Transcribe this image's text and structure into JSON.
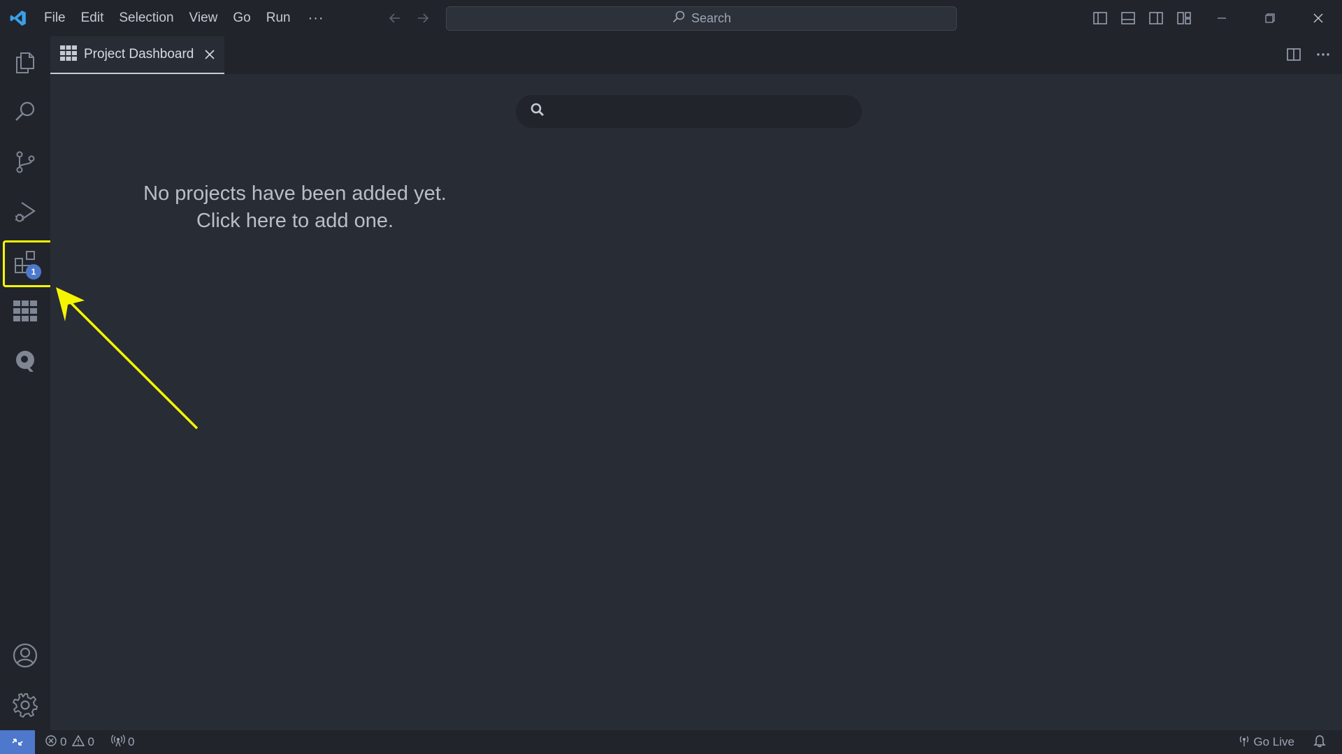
{
  "titlebar": {
    "menu": [
      "File",
      "Edit",
      "Selection",
      "View",
      "Go",
      "Run"
    ],
    "more": "···",
    "search_label": "Search"
  },
  "tab": {
    "label": "Project Dashboard"
  },
  "activity_badge": "1",
  "dashboard": {
    "search_placeholder": "",
    "empty_line1": "No projects have been added yet.",
    "empty_line2": "Click here to add one."
  },
  "statusbar": {
    "errors": "0",
    "warnings": "0",
    "ports": "0",
    "go_live": "Go Live"
  },
  "colors": {
    "accent": "#4d78cc",
    "highlight": "#f5f500",
    "background": "#282c34",
    "chrome": "#21252b"
  }
}
